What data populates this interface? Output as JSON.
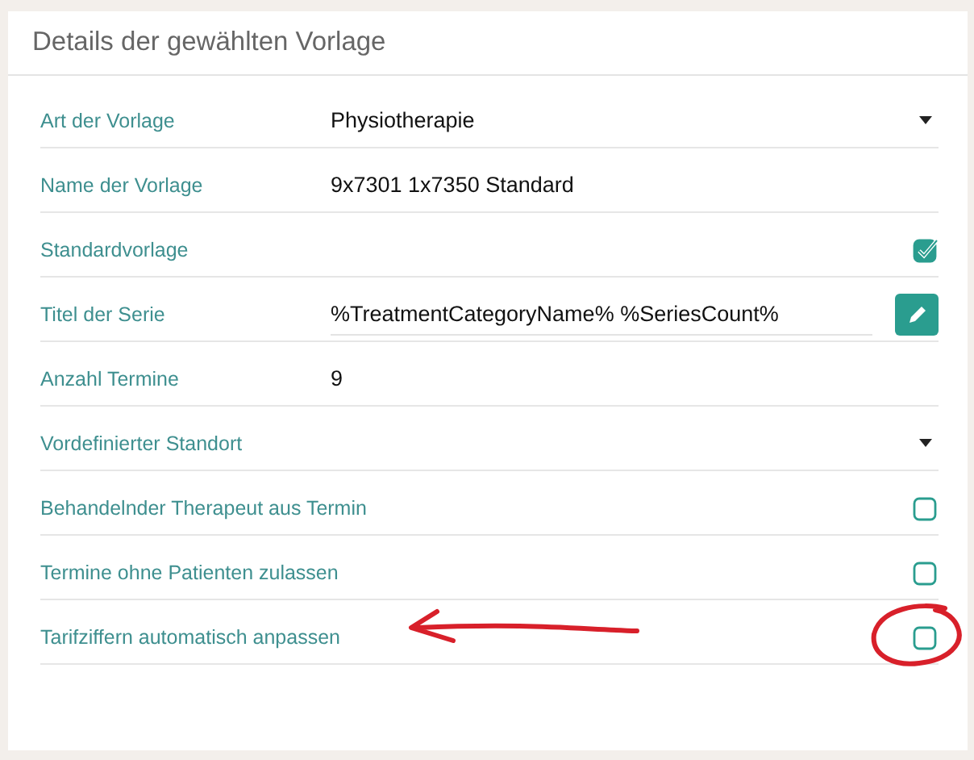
{
  "panel": {
    "title": "Details der gewählten Vorlage"
  },
  "rows": [
    {
      "kind": "select",
      "label": "Art der Vorlage",
      "value": "Physiotherapie"
    },
    {
      "kind": "text",
      "label": "Name der Vorlage",
      "value": "9x7301 1x7350 Standard"
    },
    {
      "kind": "checkbox",
      "label": "Standardvorlage",
      "checked": true
    },
    {
      "kind": "text-button",
      "label": "Titel der Serie",
      "value": "%TreatmentCategoryName% %SeriesCount%"
    },
    {
      "kind": "text",
      "label": "Anzahl Termine",
      "value": "9"
    },
    {
      "kind": "select",
      "label": "Vordefinierter Standort"
    },
    {
      "kind": "checkbox",
      "label": "Behandelnder Therapeut aus Termin",
      "checked": false
    },
    {
      "kind": "checkbox",
      "label": "Termine ohne Patienten zulassen",
      "checked": false
    },
    {
      "kind": "checkbox",
      "label": "Tarifziffern automatisch anpassen",
      "checked": false
    }
  ]
}
